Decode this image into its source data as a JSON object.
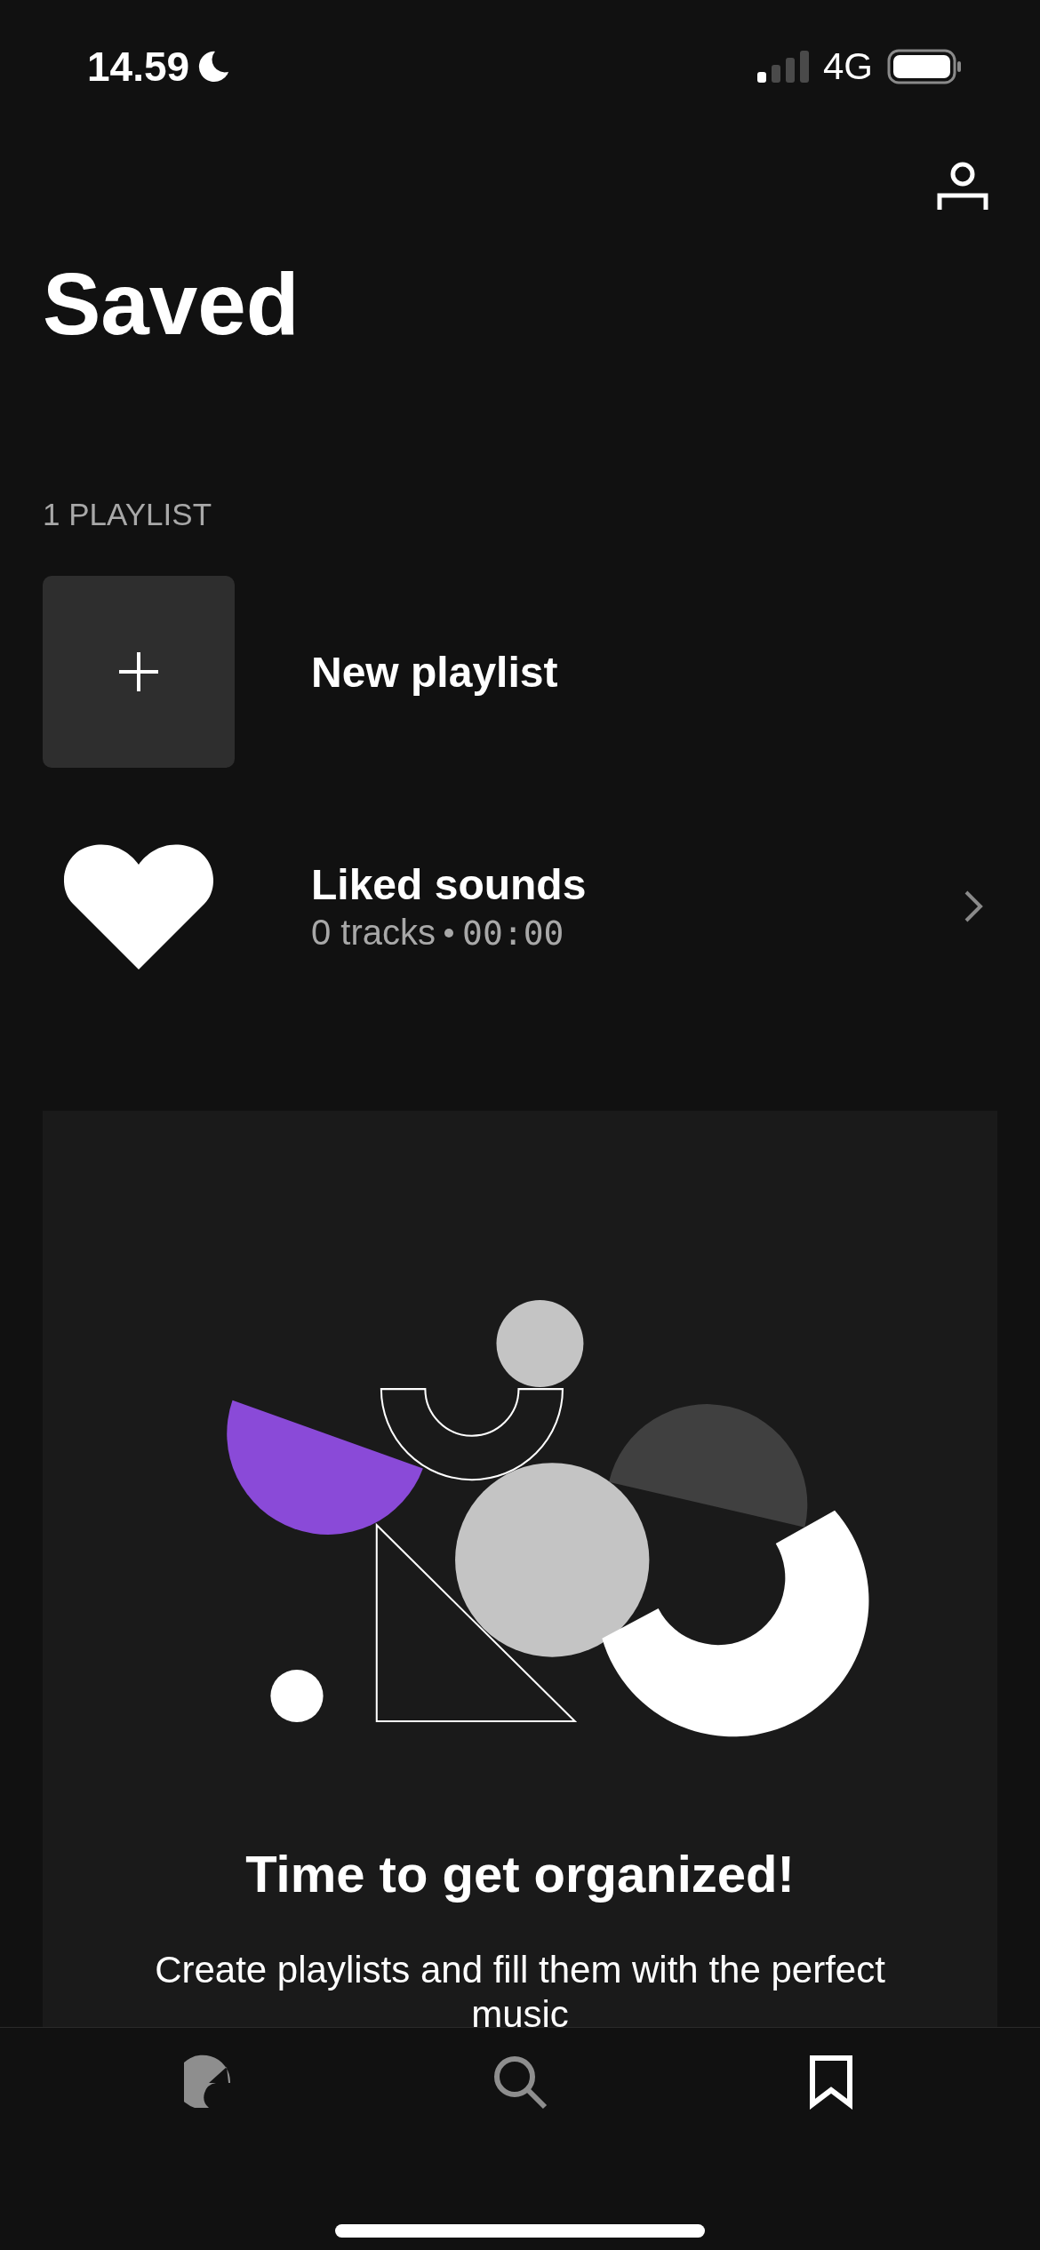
{
  "status_bar": {
    "time": "14.59",
    "network": "4G"
  },
  "header": {
    "title": "Saved"
  },
  "section_label": "1 PLAYLIST",
  "playlists": [
    {
      "kind": "create",
      "title": "New playlist"
    },
    {
      "kind": "liked",
      "title": "Liked sounds",
      "tracks": "0 tracks",
      "duration": "00:00"
    }
  ],
  "empty_state": {
    "title": "Time to get organized!",
    "text": "Create playlists and fill them with the perfect music"
  },
  "tab_bar": [
    {
      "kind": "home",
      "selected": false
    },
    {
      "kind": "search",
      "selected": false
    },
    {
      "kind": "saved",
      "selected": true
    }
  ]
}
